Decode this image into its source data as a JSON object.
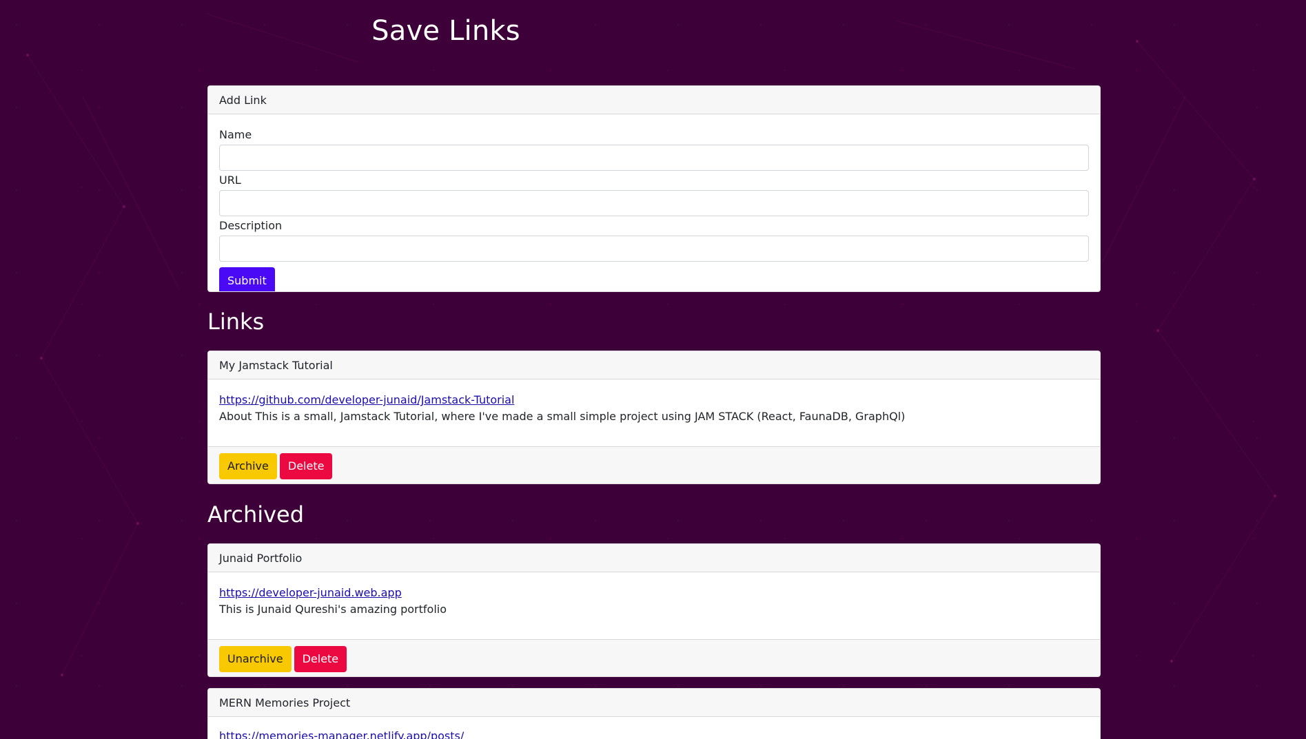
{
  "page": {
    "title": "Save Links"
  },
  "add_link": {
    "header": "Add Link",
    "name_label": "Name",
    "url_label": "URL",
    "description_label": "Description",
    "name_value": "",
    "url_value": "",
    "description_value": "",
    "submit_label": "Submit"
  },
  "links_section": {
    "title": "Links",
    "items": [
      {
        "name": "My Jamstack Tutorial",
        "url": "https://github.com/developer-junaid/Jamstack-Tutorial",
        "description": "About This is a small, Jamstack Tutorial, where I've made a small simple project using JAM STACK (React, FaunaDB, GraphQl)",
        "archive_label": "Archive",
        "delete_label": "Delete"
      }
    ]
  },
  "archived_section": {
    "title": "Archived",
    "items": [
      {
        "name": "Junaid Portfolio",
        "url": "https://developer-junaid.web.app",
        "description": "This is Junaid Qureshi's amazing portfolio",
        "unarchive_label": "Unarchive",
        "delete_label": "Delete"
      },
      {
        "name": "MERN Memories Project",
        "url": "https://memories-manager.netlify.app/posts/"
      }
    ]
  },
  "colors": {
    "background": "#3d0038",
    "submit": "#4a0af5",
    "archive": "#f8c800",
    "delete": "#ec0840",
    "link": "#1a0dab"
  }
}
